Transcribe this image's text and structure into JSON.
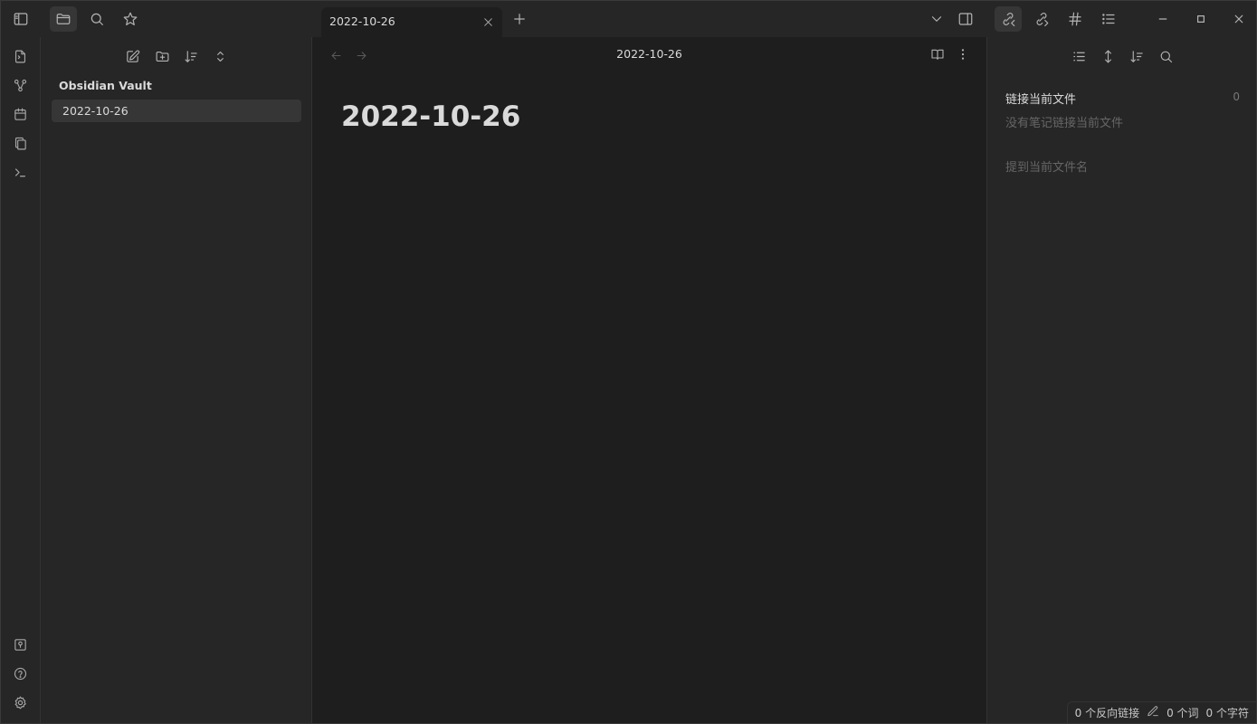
{
  "tab": {
    "title": "2022-10-26",
    "close_icon": "close-icon",
    "new_tab_icon": "plus-icon"
  },
  "titlebar": {
    "left_icons": [
      "sidebar-toggle-icon",
      "folder-icon",
      "search-icon",
      "star-icon"
    ],
    "right_icons": [
      "chevron-down-icon",
      "sidebar-right-toggle-icon",
      "backlinks-icon",
      "outgoing-links-icon",
      "tag-icon",
      "outline-icon"
    ],
    "window_controls": [
      "minimize-icon",
      "maximize-icon",
      "close-window-icon"
    ]
  },
  "ribbon": {
    "top_icons": [
      "quick-switcher-icon",
      "graph-icon",
      "calendar-icon",
      "templates-icon",
      "terminal-icon"
    ],
    "bottom_icons": [
      "vault-icon",
      "help-icon",
      "settings-icon"
    ]
  },
  "file_explorer": {
    "toolbar_icons": [
      "new-note-icon",
      "new-folder-icon",
      "sort-icon",
      "collapse-icon"
    ],
    "vault_name": "Obsidian Vault",
    "files": [
      {
        "name": "2022-10-26",
        "active": true
      }
    ]
  },
  "editor": {
    "view_title": "2022-10-26",
    "note_title": "2022-10-26",
    "nav_icons": [
      "arrow-left-icon",
      "arrow-right-icon"
    ],
    "actions_icons": [
      "reading-view-icon",
      "more-options-icon"
    ]
  },
  "backlinks": {
    "toolbar_icons": [
      "collapse-results-icon",
      "expand-icon",
      "sort-icon",
      "search-icon"
    ],
    "linked_header": "链接当前文件",
    "linked_count": "0",
    "linked_empty": "没有笔记链接当前文件",
    "unlinked_header": "提到当前文件名"
  },
  "statusbar": {
    "backlinks": "0 个反向链接",
    "words": "0 个词",
    "chars": "0 个字符"
  },
  "colors": {
    "background": "#1e1e1e",
    "panel": "#262626",
    "active_item": "#363636",
    "text": "#dadada",
    "muted": "#666666"
  }
}
